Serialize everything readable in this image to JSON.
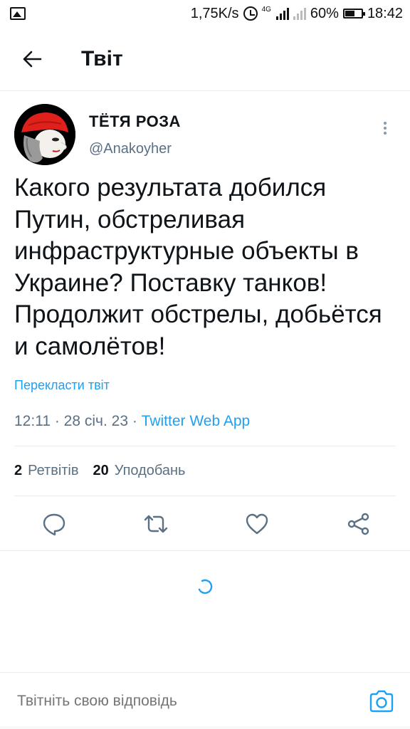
{
  "status_bar": {
    "speed": "1,75K/s",
    "network_type": "4G",
    "battery": "60%",
    "time": "18:42"
  },
  "header": {
    "title": "Твіт",
    "back_icon": "arrow-left-icon"
  },
  "tweet": {
    "author": {
      "name": "ТЁТЯ РОЗА",
      "handle": "@Anakoyher"
    },
    "text": "Какого результата добился Путин, обстреливая инфраструктурные объекты в Украине? Поставку танков! Продолжит обстрелы, добьётся и самолётов!",
    "translate_label": "Перекласти твіт",
    "time": "12:11",
    "date": "28 січ. 23",
    "source": "Twitter Web App",
    "separator": " · ",
    "stats": {
      "retweets_count": "2",
      "retweets_label": "Ретвітів",
      "likes_count": "20",
      "likes_label": "Уподобань"
    },
    "actions": [
      "reply-icon",
      "retweet-icon",
      "like-icon",
      "share-icon"
    ]
  },
  "reply": {
    "placeholder": "Твітніть свою відповідь",
    "camera_icon": "camera-icon"
  },
  "colors": {
    "accent": "#1da1f2",
    "secondary_text": "#5b7083",
    "divider": "#e6ecf0",
    "avatar_hat": "#e0201b"
  }
}
